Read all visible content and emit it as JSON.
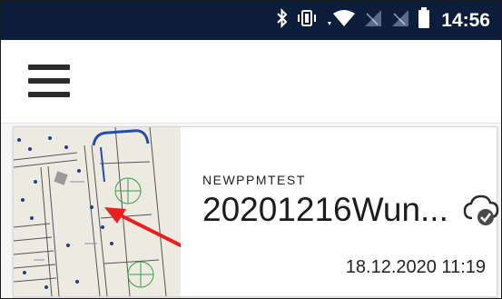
{
  "status_bar": {
    "time": "14:56",
    "icons": [
      "bluetooth-icon",
      "vibrate-icon",
      "wifi-icon",
      "signal-icon",
      "signal-icon",
      "battery-icon"
    ]
  },
  "app_bar": {
    "menu_icon": "hamburger-menu-icon"
  },
  "card": {
    "label": "NEWPPMTEST",
    "title": "20201216Wun...",
    "date": "18.12.2020 11:19",
    "sync_icon": "cloud-check-icon",
    "thumbnail_icon": "floor-plan-thumbnail",
    "annotation_color": "#e8211f"
  },
  "colors": {
    "status_bar_bg": "#0d1e3d",
    "text_dark": "#1c1c1c"
  }
}
